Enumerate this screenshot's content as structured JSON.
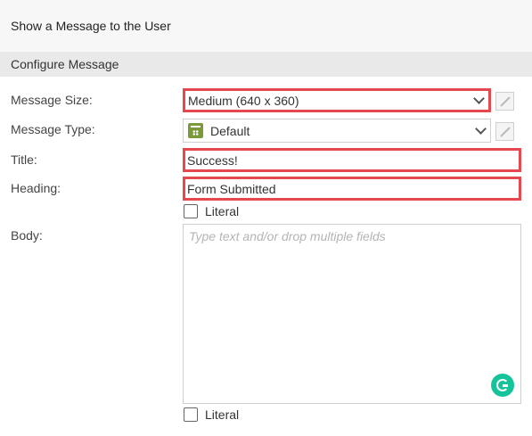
{
  "header": {
    "title": "Show a Message to the User"
  },
  "section": {
    "title": "Configure Message"
  },
  "form": {
    "message_size": {
      "label": "Message Size:",
      "value": "Medium (640 x 360)"
    },
    "message_type": {
      "label": "Message Type:",
      "value": "Default",
      "icon": "message-type-icon"
    },
    "title": {
      "label": "Title:",
      "value": "Success!"
    },
    "heading": {
      "label": "Heading:",
      "value": "Form Submitted"
    },
    "heading_literal": {
      "label": "Literal"
    },
    "body": {
      "label": "Body:",
      "placeholder": "Type text and/or drop multiple fields"
    },
    "body_literal": {
      "label": "Literal"
    }
  },
  "colors": {
    "highlight": "#e5484d",
    "grammarly": "#15c39a",
    "type_icon": "#7a9a3a"
  }
}
